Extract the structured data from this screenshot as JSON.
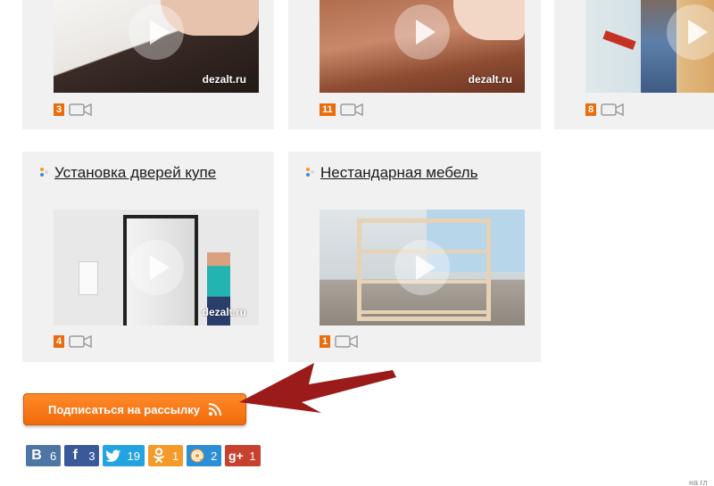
{
  "top_row": [
    {
      "count": "3",
      "watermark": "dezalt.ru"
    },
    {
      "count": "11",
      "watermark": "dezalt.ru"
    },
    {
      "count": "8"
    }
  ],
  "cards": [
    {
      "title": "Установка дверей купе",
      "count": "4",
      "watermark": "dezalt.ru"
    },
    {
      "title": "Нестандарная мебель",
      "count": "1"
    }
  ],
  "subscribe_label": "Подписаться на рассылку",
  "shares": [
    {
      "network": "vk",
      "icon": "В",
      "count": "6",
      "color": "#4f75a5"
    },
    {
      "network": "facebook",
      "icon": "f",
      "count": "3",
      "color": "#3b5998"
    },
    {
      "network": "twitter",
      "icon": "🐦",
      "count": "19",
      "color": "#23a4e0"
    },
    {
      "network": "odnoklassniki",
      "icon": "ok",
      "count": "1",
      "color": "#f39a28"
    },
    {
      "network": "mailru",
      "icon": "@",
      "count": "2",
      "color": "#2a8fd6"
    },
    {
      "network": "googleplus",
      "icon": "g+",
      "count": "1",
      "color": "#c8412f"
    }
  ],
  "footer_fragment": "на гл"
}
